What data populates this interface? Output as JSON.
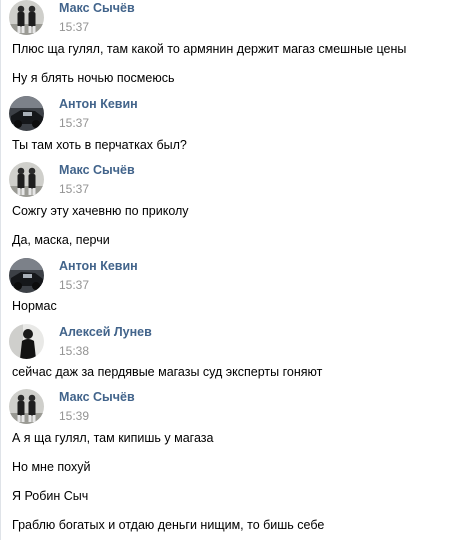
{
  "authors": {
    "maks": "Макс Сычёв",
    "anton": "Антон Кевин",
    "aleksey": "Алексей Лунев"
  },
  "blocks": [
    {
      "time": "15:37",
      "messages": [
        "Плюс ща гулял, там какой то армянин держит магаз смешные цены",
        "Ну я блять ночью посмеюсь"
      ]
    },
    {
      "time": "15:37",
      "messages": [
        "Ты там хоть в перчатках был?"
      ]
    },
    {
      "time": "15:37",
      "messages": [
        "Сожгу эту хачевню по приколу",
        "Да, маска, перчи"
      ]
    },
    {
      "time": "15:37",
      "messages": [
        "Нормас"
      ]
    },
    {
      "time": "15:38",
      "messages": [
        "сейчас даж за пердявые магазы суд эксперты гоняют"
      ]
    },
    {
      "time": "15:39",
      "messages": [
        "А я ща гулял, там кипишь у магаза",
        "Но мне похуй",
        "Я Робин Сыч",
        "Граблю богатых и отдаю деньги нищим, то бишь себе"
      ]
    }
  ]
}
